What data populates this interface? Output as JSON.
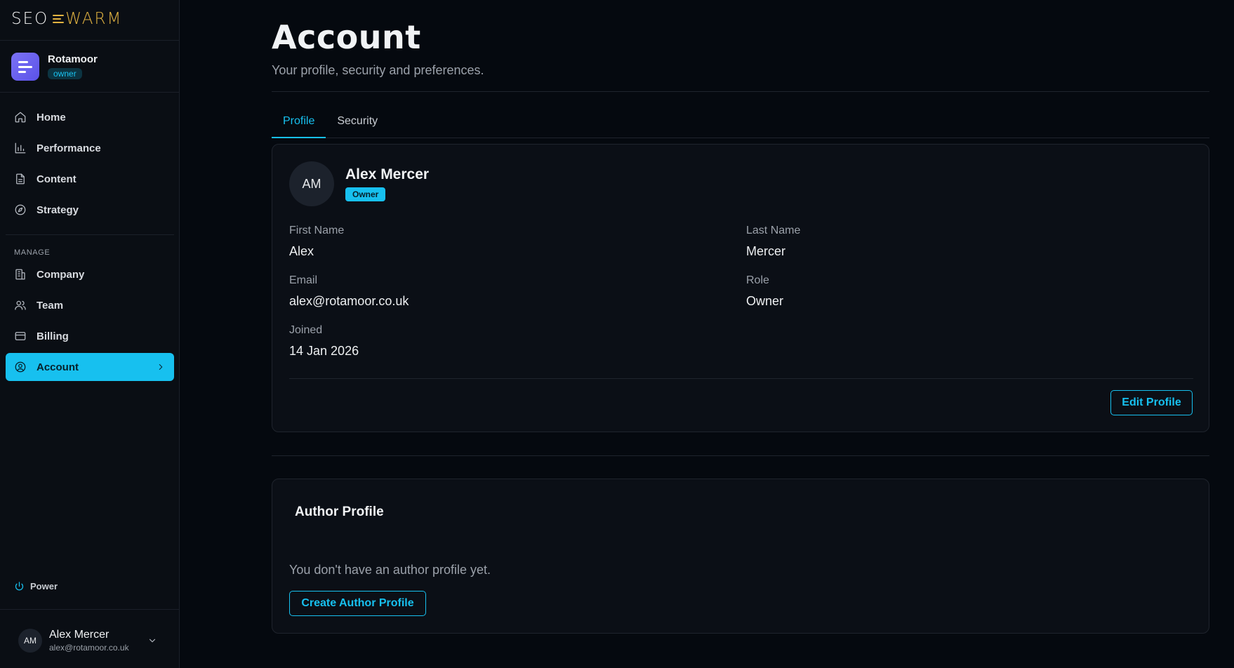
{
  "brand": {
    "logo_left": "SEO",
    "logo_right": "WARM"
  },
  "org": {
    "name": "Rotamoor",
    "badge": "owner"
  },
  "nav": {
    "items": [
      {
        "label": "Home",
        "icon": "home-icon"
      },
      {
        "label": "Performance",
        "icon": "bar-chart-icon"
      },
      {
        "label": "Content",
        "icon": "document-icon"
      },
      {
        "label": "Strategy",
        "icon": "compass-icon"
      }
    ],
    "manage_label": "MANAGE",
    "manage_items": [
      {
        "label": "Company",
        "icon": "building-icon"
      },
      {
        "label": "Team",
        "icon": "users-icon"
      },
      {
        "label": "Billing",
        "icon": "credit-card-icon"
      },
      {
        "label": "Account",
        "icon": "user-circle-icon",
        "active": true
      }
    ]
  },
  "power": {
    "label": "Power"
  },
  "user": {
    "initials": "AM",
    "name": "Alex Mercer",
    "email": "alex@rotamoor.co.uk"
  },
  "page": {
    "title": "Account",
    "subtitle": "Your profile, security and preferences."
  },
  "tabs": [
    {
      "label": "Profile",
      "active": true
    },
    {
      "label": "Security",
      "active": false
    }
  ],
  "profile": {
    "initials": "AM",
    "name": "Alex Mercer",
    "role_badge": "Owner",
    "fields": {
      "first_name": {
        "label": "First Name",
        "value": "Alex"
      },
      "last_name": {
        "label": "Last Name",
        "value": "Mercer"
      },
      "email": {
        "label": "Email",
        "value": "alex@rotamoor.co.uk"
      },
      "role": {
        "label": "Role",
        "value": "Owner"
      },
      "joined": {
        "label": "Joined",
        "value": "14 Jan 2026"
      }
    },
    "edit_button": "Edit Profile"
  },
  "author": {
    "title": "Author Profile",
    "message": "You don't have an author profile yet.",
    "create_button": "Create Author Profile"
  },
  "colors": {
    "accent": "#17c0ef",
    "brand_gold": "#e2b341",
    "background": "#05090f",
    "org_avatar": "#6b62ee"
  }
}
